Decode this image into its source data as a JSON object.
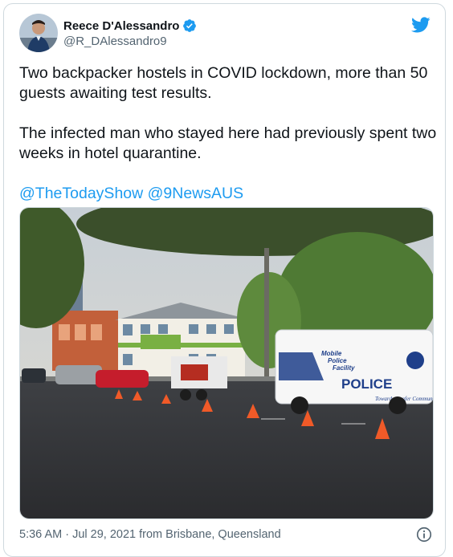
{
  "author": {
    "display_name": "Reece D'Alessandro",
    "handle": "@R_DAlessandro9"
  },
  "tweet": {
    "paragraph_1": "Two backpacker hostels in COVID lockdown, more than 50 guests awaiting test results.",
    "paragraph_2": "The infected man who stayed here had previously spent two weeks in hotel quarantine.",
    "mentions": [
      "@TheTodayShow",
      "@9NewsAUS"
    ]
  },
  "media": {
    "police_van_text": {
      "line_1": "Mobile",
      "line_2": "Police",
      "line_3": "Facility",
      "main": "POLICE",
      "motto": "Towards a safer Community"
    }
  },
  "meta": {
    "timestamp": "5:36 AM · Jul 29, 2021 from Brisbane, Queensland"
  },
  "icons": {
    "verified": "verified-badge-icon",
    "logo": "twitter-bird-icon",
    "info": "info-icon"
  },
  "colors": {
    "accent": "#1d9bf0",
    "text": "#0f1419",
    "secondary": "#536471",
    "border": "#cfd9de"
  }
}
